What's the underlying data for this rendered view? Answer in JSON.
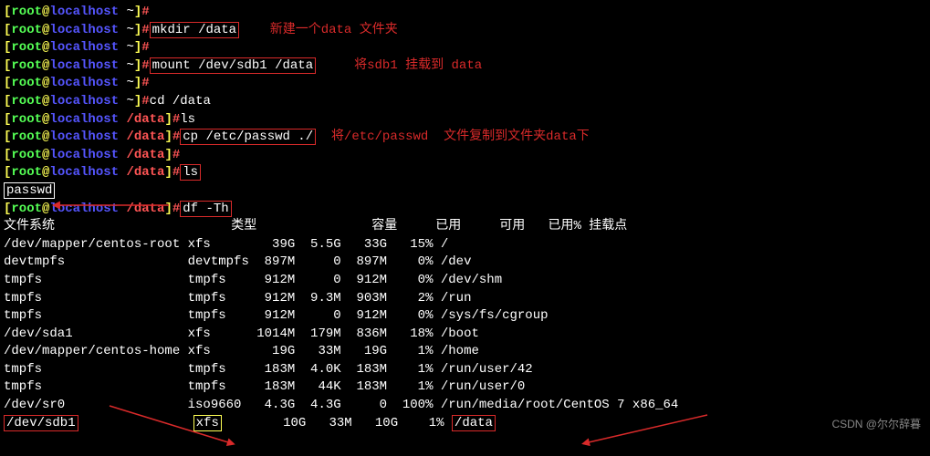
{
  "prompt": {
    "br_open": "[",
    "user": "root",
    "at": "@",
    "host": "localhost",
    "path_home": " ~",
    "path_data": " /data",
    "br_close": "]",
    "hash": "#"
  },
  "cmds": {
    "empty": "",
    "mkdir": "mkdir /data",
    "mount": "mount /dev/sdb1 /data",
    "cd": "cd /data",
    "ls1": "ls",
    "cp": "cp /etc/passwd ./",
    "ls2": "ls",
    "df": "df -Th"
  },
  "output": {
    "passwd": "passwd"
  },
  "annot": {
    "mkdir": "新建一个data 文件夹",
    "mount": "将sdb1 挂载到 data",
    "cp": "将/etc/passwd  文件复制到文件夹data下"
  },
  "df_header": {
    "fs": "文件系统",
    "type": "类型",
    "size": "容量",
    "used": "已用",
    "avail": "可用",
    "usep": "已用%",
    "mount": "挂载点"
  },
  "df_rows": [
    {
      "fs": "/dev/mapper/centos-root",
      "type": "xfs",
      "size": "39G",
      "used": "5.5G",
      "avail": "33G",
      "usep": "15%",
      "mount": "/"
    },
    {
      "fs": "devtmpfs",
      "type": "devtmpfs",
      "size": "897M",
      "used": "0",
      "avail": "897M",
      "usep": "0%",
      "mount": "/dev"
    },
    {
      "fs": "tmpfs",
      "type": "tmpfs",
      "size": "912M",
      "used": "0",
      "avail": "912M",
      "usep": "0%",
      "mount": "/dev/shm"
    },
    {
      "fs": "tmpfs",
      "type": "tmpfs",
      "size": "912M",
      "used": "9.3M",
      "avail": "903M",
      "usep": "2%",
      "mount": "/run"
    },
    {
      "fs": "tmpfs",
      "type": "tmpfs",
      "size": "912M",
      "used": "0",
      "avail": "912M",
      "usep": "0%",
      "mount": "/sys/fs/cgroup"
    },
    {
      "fs": "/dev/sda1",
      "type": "xfs",
      "size": "1014M",
      "used": "179M",
      "avail": "836M",
      "usep": "18%",
      "mount": "/boot"
    },
    {
      "fs": "/dev/mapper/centos-home",
      "type": "xfs",
      "size": "19G",
      "used": "33M",
      "avail": "19G",
      "usep": "1%",
      "mount": "/home"
    },
    {
      "fs": "tmpfs",
      "type": "tmpfs",
      "size": "183M",
      "used": "4.0K",
      "avail": "183M",
      "usep": "1%",
      "mount": "/run/user/42"
    },
    {
      "fs": "tmpfs",
      "type": "tmpfs",
      "size": "183M",
      "used": "44K",
      "avail": "183M",
      "usep": "1%",
      "mount": "/run/user/0"
    },
    {
      "fs": "/dev/sr0",
      "type": "iso9660",
      "size": "4.3G",
      "used": "4.3G",
      "avail": "0",
      "usep": "100%",
      "mount": "/run/media/root/CentOS 7 x86_64"
    }
  ],
  "df_last": {
    "fs": "/dev/sdb1",
    "type": "xfs",
    "size": "10G",
    "used": "33M",
    "avail": "10G",
    "usep": "1%",
    "mount": "/data"
  },
  "watermark": "CSDN @尔尔辞暮"
}
